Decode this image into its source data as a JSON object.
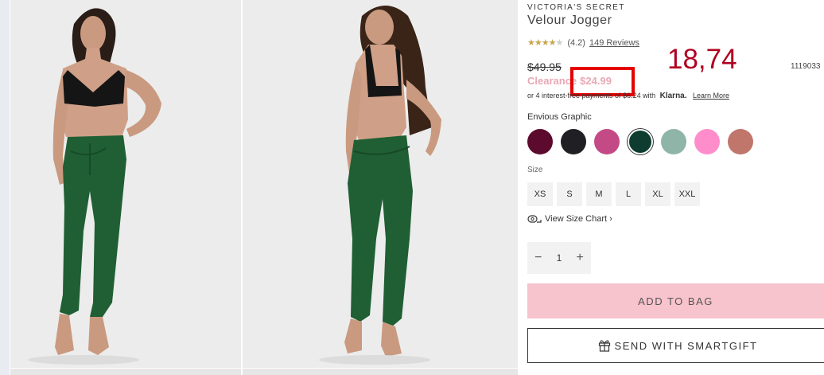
{
  "product": {
    "brand": "VICTORIA'S SECRET",
    "name": "Velour Jogger",
    "rating_value": 4.2,
    "rating_text": "(4.2)",
    "reviews_text": "149 Reviews",
    "old_price": "$49.95",
    "sale_label": "Clearance",
    "sale_price": "$24.99",
    "sku": "1119033",
    "klarna_text": "or 4 interest-free payments of $6.24 with",
    "klarna_brand": "Klarna.",
    "klarna_link": "Learn More"
  },
  "annotation": "18,74",
  "color": {
    "label": "Envious Graphic",
    "swatches": [
      {
        "name": "burgundy",
        "hex": "#5c0a2e"
      },
      {
        "name": "black",
        "hex": "#1f1f24"
      },
      {
        "name": "magenta",
        "hex": "#c44a86"
      },
      {
        "name": "dark-green",
        "hex": "#0e3d30",
        "selected": true
      },
      {
        "name": "sage",
        "hex": "#8fb5a8"
      },
      {
        "name": "pink",
        "hex": "#ff8dcc"
      },
      {
        "name": "terracotta",
        "hex": "#c0766a"
      }
    ]
  },
  "size": {
    "label": "Size",
    "options": [
      "XS",
      "S",
      "M",
      "L",
      "XL",
      "XXL"
    ],
    "chart_link": "View Size Chart ›"
  },
  "quantity": {
    "value": "1",
    "minus": "−",
    "plus": "+"
  },
  "buttons": {
    "add_to_bag": "ADD TO BAG",
    "smartgift": "SEND WITH SMARTGIFT"
  },
  "colors": {
    "sale_pink": "#e9a8b4",
    "add_bag_bg": "#f7c3cc",
    "annotation_red": "#b00020",
    "highlight_box": "#e60000",
    "jogger_green": "#1f5f33"
  }
}
